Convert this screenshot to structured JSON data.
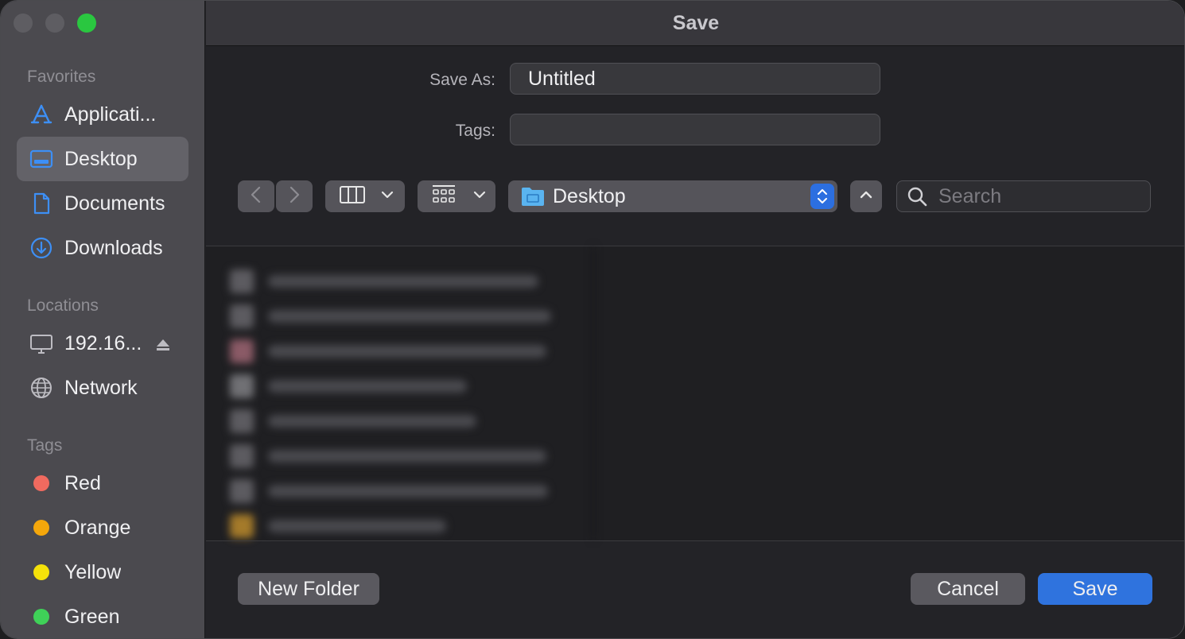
{
  "window": {
    "title": "Save"
  },
  "sidebar": {
    "favorites_title": "Favorites",
    "favorites": [
      {
        "label": "Applicati...",
        "icon": "applications-icon"
      },
      {
        "label": "Desktop",
        "icon": "desktop-folder-icon",
        "selected": true
      },
      {
        "label": "Documents",
        "icon": "document-icon"
      },
      {
        "label": "Downloads",
        "icon": "download-icon"
      }
    ],
    "locations_title": "Locations",
    "locations": [
      {
        "label": "192.16...",
        "icon": "computer-icon",
        "eject": true
      },
      {
        "label": "Network",
        "icon": "network-globe-icon"
      }
    ],
    "tags_title": "Tags",
    "tags": [
      {
        "label": "Red",
        "color": "#f06a5f"
      },
      {
        "label": "Orange",
        "color": "#f5a70b"
      },
      {
        "label": "Yellow",
        "color": "#f5e20a"
      },
      {
        "label": "Green",
        "color": "#3fd158"
      }
    ]
  },
  "form": {
    "save_as_label": "Save As:",
    "save_as_value": "Untitled",
    "tags_label": "Tags:",
    "tags_value": ""
  },
  "toolbar": {
    "location": "Desktop",
    "search_placeholder": "Search"
  },
  "footer": {
    "new_folder": "New Folder",
    "cancel": "Cancel",
    "save": "Save"
  },
  "colors": {
    "accent": "#2f73de",
    "folder_blue": "#5ab4f0"
  }
}
